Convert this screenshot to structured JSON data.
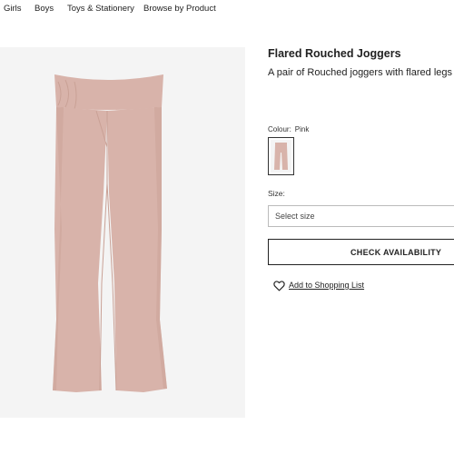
{
  "nav": {
    "items": [
      {
        "label": "Girls"
      },
      {
        "label": "Boys"
      },
      {
        "label": "Toys & Stationery"
      },
      {
        "label": "Browse by Product"
      }
    ]
  },
  "product": {
    "title": "Flared Rouched Joggers",
    "description": "A pair of Rouched joggers with flared legs",
    "colour_label": "Colour:",
    "colour_value": "Pink",
    "swatch_color": "#d9b6ad",
    "size_label": "Size:",
    "size_placeholder": "Select size",
    "check_availability": "CHECK AVAILABILITY",
    "add_to_list": "Add to Shopping List"
  },
  "colors": {
    "image_bg": "#f4f4f4",
    "pants": "#d8b3aa",
    "pants_shadow": "#c9a196"
  },
  "icons": {
    "add_to_list": "heart-icon"
  }
}
